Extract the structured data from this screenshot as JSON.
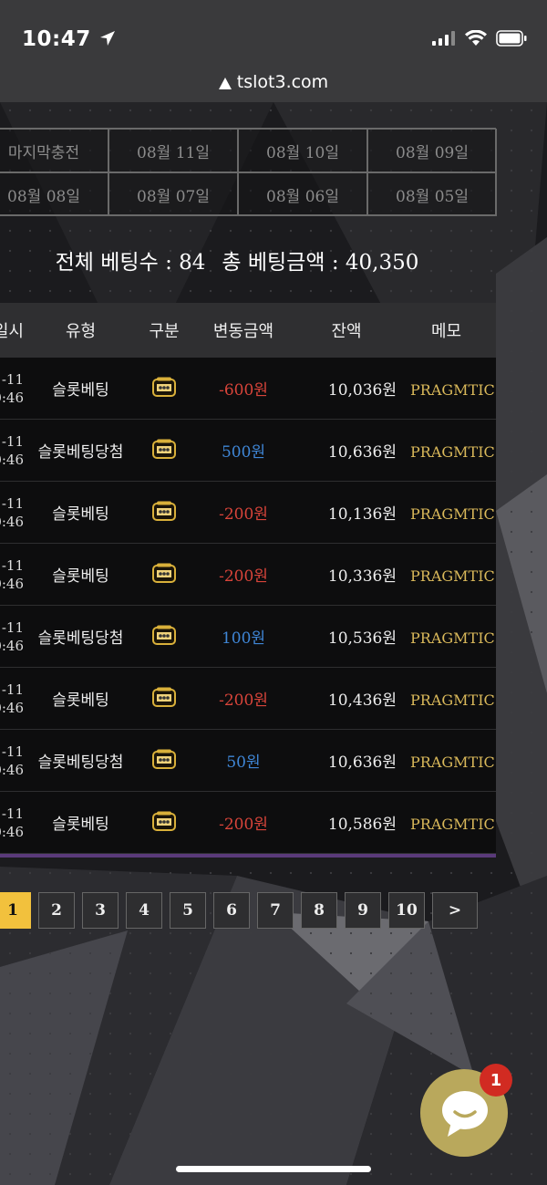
{
  "status_bar": {
    "time": "10:47",
    "url": "tslot3.com"
  },
  "date_tabs": [
    "마지막충전",
    "08월 11일",
    "08월 10일",
    "08월 09일",
    "08월 08일",
    "08월 07일",
    "08월 06일",
    "08월 05일"
  ],
  "summary": {
    "total_count_label": "전체 베팅수 : 84",
    "total_amount_label": "총 베팅금액 : 40,350"
  },
  "table": {
    "headers": [
      "일시",
      "유형",
      "구분",
      "변동금액",
      "잔액",
      "메모"
    ],
    "rows": [
      {
        "date": "-11",
        "time": "0:46",
        "type": "슬롯베팅",
        "amount": "-600원",
        "sign": "neg",
        "balance": "10,036원",
        "memo": "PRAGMTIC:큰"
      },
      {
        "date": "-11",
        "time": "0:46",
        "type": "슬롯베팅당첨",
        "amount": "500원",
        "sign": "pos",
        "balance": "10,636원",
        "memo": "PRAGMTIC:큰"
      },
      {
        "date": "-11",
        "time": "0:46",
        "type": "슬롯베팅",
        "amount": "-200원",
        "sign": "neg",
        "balance": "10,136원",
        "memo": "PRAGMTIC:큰"
      },
      {
        "date": "-11",
        "time": "0:46",
        "type": "슬롯베팅",
        "amount": "-200원",
        "sign": "neg",
        "balance": "10,336원",
        "memo": "PRAGMTIC:큰"
      },
      {
        "date": "-11",
        "time": "0:46",
        "type": "슬롯베팅당첨",
        "amount": "100원",
        "sign": "pos",
        "balance": "10,536원",
        "memo": "PRAGMTIC:큰"
      },
      {
        "date": "-11",
        "time": "0:46",
        "type": "슬롯베팅",
        "amount": "-200원",
        "sign": "neg",
        "balance": "10,436원",
        "memo": "PRAGMTIC:큰"
      },
      {
        "date": "-11",
        "time": "0:46",
        "type": "슬롯베팅당첨",
        "amount": "50원",
        "sign": "pos",
        "balance": "10,636원",
        "memo": "PRAGMTIC:큰"
      },
      {
        "date": "-11",
        "time": "0:46",
        "type": "슬롯베팅",
        "amount": "-200원",
        "sign": "neg",
        "balance": "10,586원",
        "memo": "PRAGMTIC:큰"
      }
    ]
  },
  "pagination": {
    "pages": [
      "1",
      "2",
      "3",
      "4",
      "5",
      "6",
      "7",
      "8",
      "9",
      "10"
    ],
    "active": "1",
    "next": ">"
  },
  "chat": {
    "badge": "1"
  },
  "colors": {
    "accent": "#f2c13d",
    "negative": "#d8443a",
    "positive": "#3f86d6",
    "memo": "#d9b85a",
    "chat": "#b9a85c"
  }
}
